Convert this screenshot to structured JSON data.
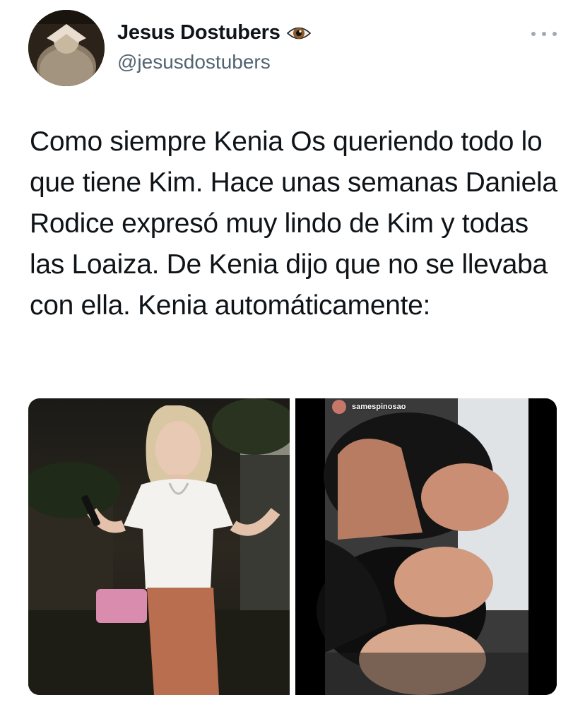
{
  "tweet": {
    "author": {
      "display_name": "Jesus Dostubers",
      "name_emoji_icon": "eye-icon",
      "handle": "@jesusdostubers",
      "avatar_icon": "user-avatar"
    },
    "more_icon": "more-options-icon",
    "text": "Como siempre Kenia Os queriendo todo lo que tiene Kim. Hace unas semanas Daniela Rodice expresó muy lindo de Kim y todas las Loaiza. De Kenia dijo que no se llevaba con ella. Kenia automáticamente:",
    "media": {
      "left_photo": "photo-woman-white-top",
      "right_photo": "photo-three-women-selfie",
      "right_overlay_username": "samespinosao"
    }
  },
  "colors": {
    "text_primary": "#0f1419",
    "text_secondary": "#536471",
    "more_dots": "#a0a9b1"
  }
}
